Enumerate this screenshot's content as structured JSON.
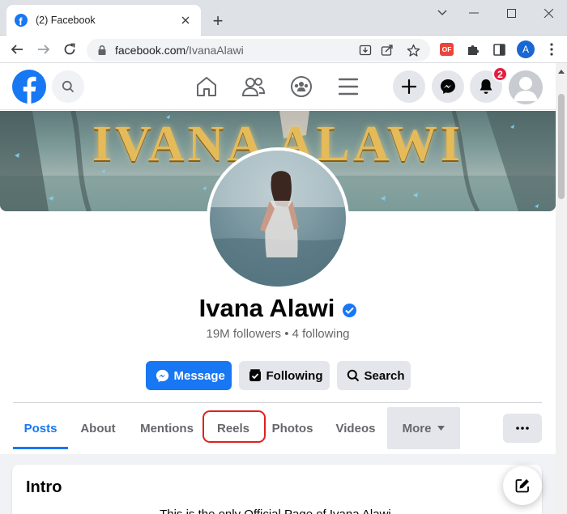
{
  "browser": {
    "tab_title": "(2) Facebook",
    "new_tab_symbol": "+",
    "url_host": "facebook.com",
    "url_path": "/IvanaAlawi",
    "extension_label": "OF",
    "profile_initial": "A"
  },
  "fb_header": {
    "notification_count": "2",
    "colors": {
      "brand": "#1877f2",
      "badge": "#e41e3f"
    }
  },
  "profile": {
    "cover_title": "IVANA ALAWI",
    "name": "Ivana Alawi",
    "stats": "19M followers • 4 following",
    "buttons": {
      "message": "Message",
      "following": "Following",
      "search": "Search"
    }
  },
  "tabs": {
    "items": [
      "Posts",
      "About",
      "Mentions",
      "Reels",
      "Photos",
      "Videos"
    ],
    "more": "More",
    "active": "Posts",
    "highlighted": "Reels"
  },
  "intro": {
    "title": "Intro",
    "text": "This is the only Official Page of Ivana Alawi."
  },
  "icons": {
    "browser": [
      "facebook-favicon-icon",
      "close-icon",
      "chevron-down-icon",
      "minimize-icon",
      "maximize-icon",
      "back-arrow-icon",
      "forward-arrow-icon",
      "reload-icon",
      "lock-icon",
      "install-icon",
      "share-icon",
      "star-icon",
      "puzzle-icon",
      "sidebar-icon",
      "kebab-menu-icon"
    ],
    "fb": [
      "facebook-logo-icon",
      "search-icon",
      "home-icon",
      "friends-icon",
      "groups-icon",
      "menu-icon",
      "plus-icon",
      "messenger-icon",
      "bell-icon",
      "verified-badge-icon",
      "compose-icon",
      "more-dots-icon"
    ]
  }
}
